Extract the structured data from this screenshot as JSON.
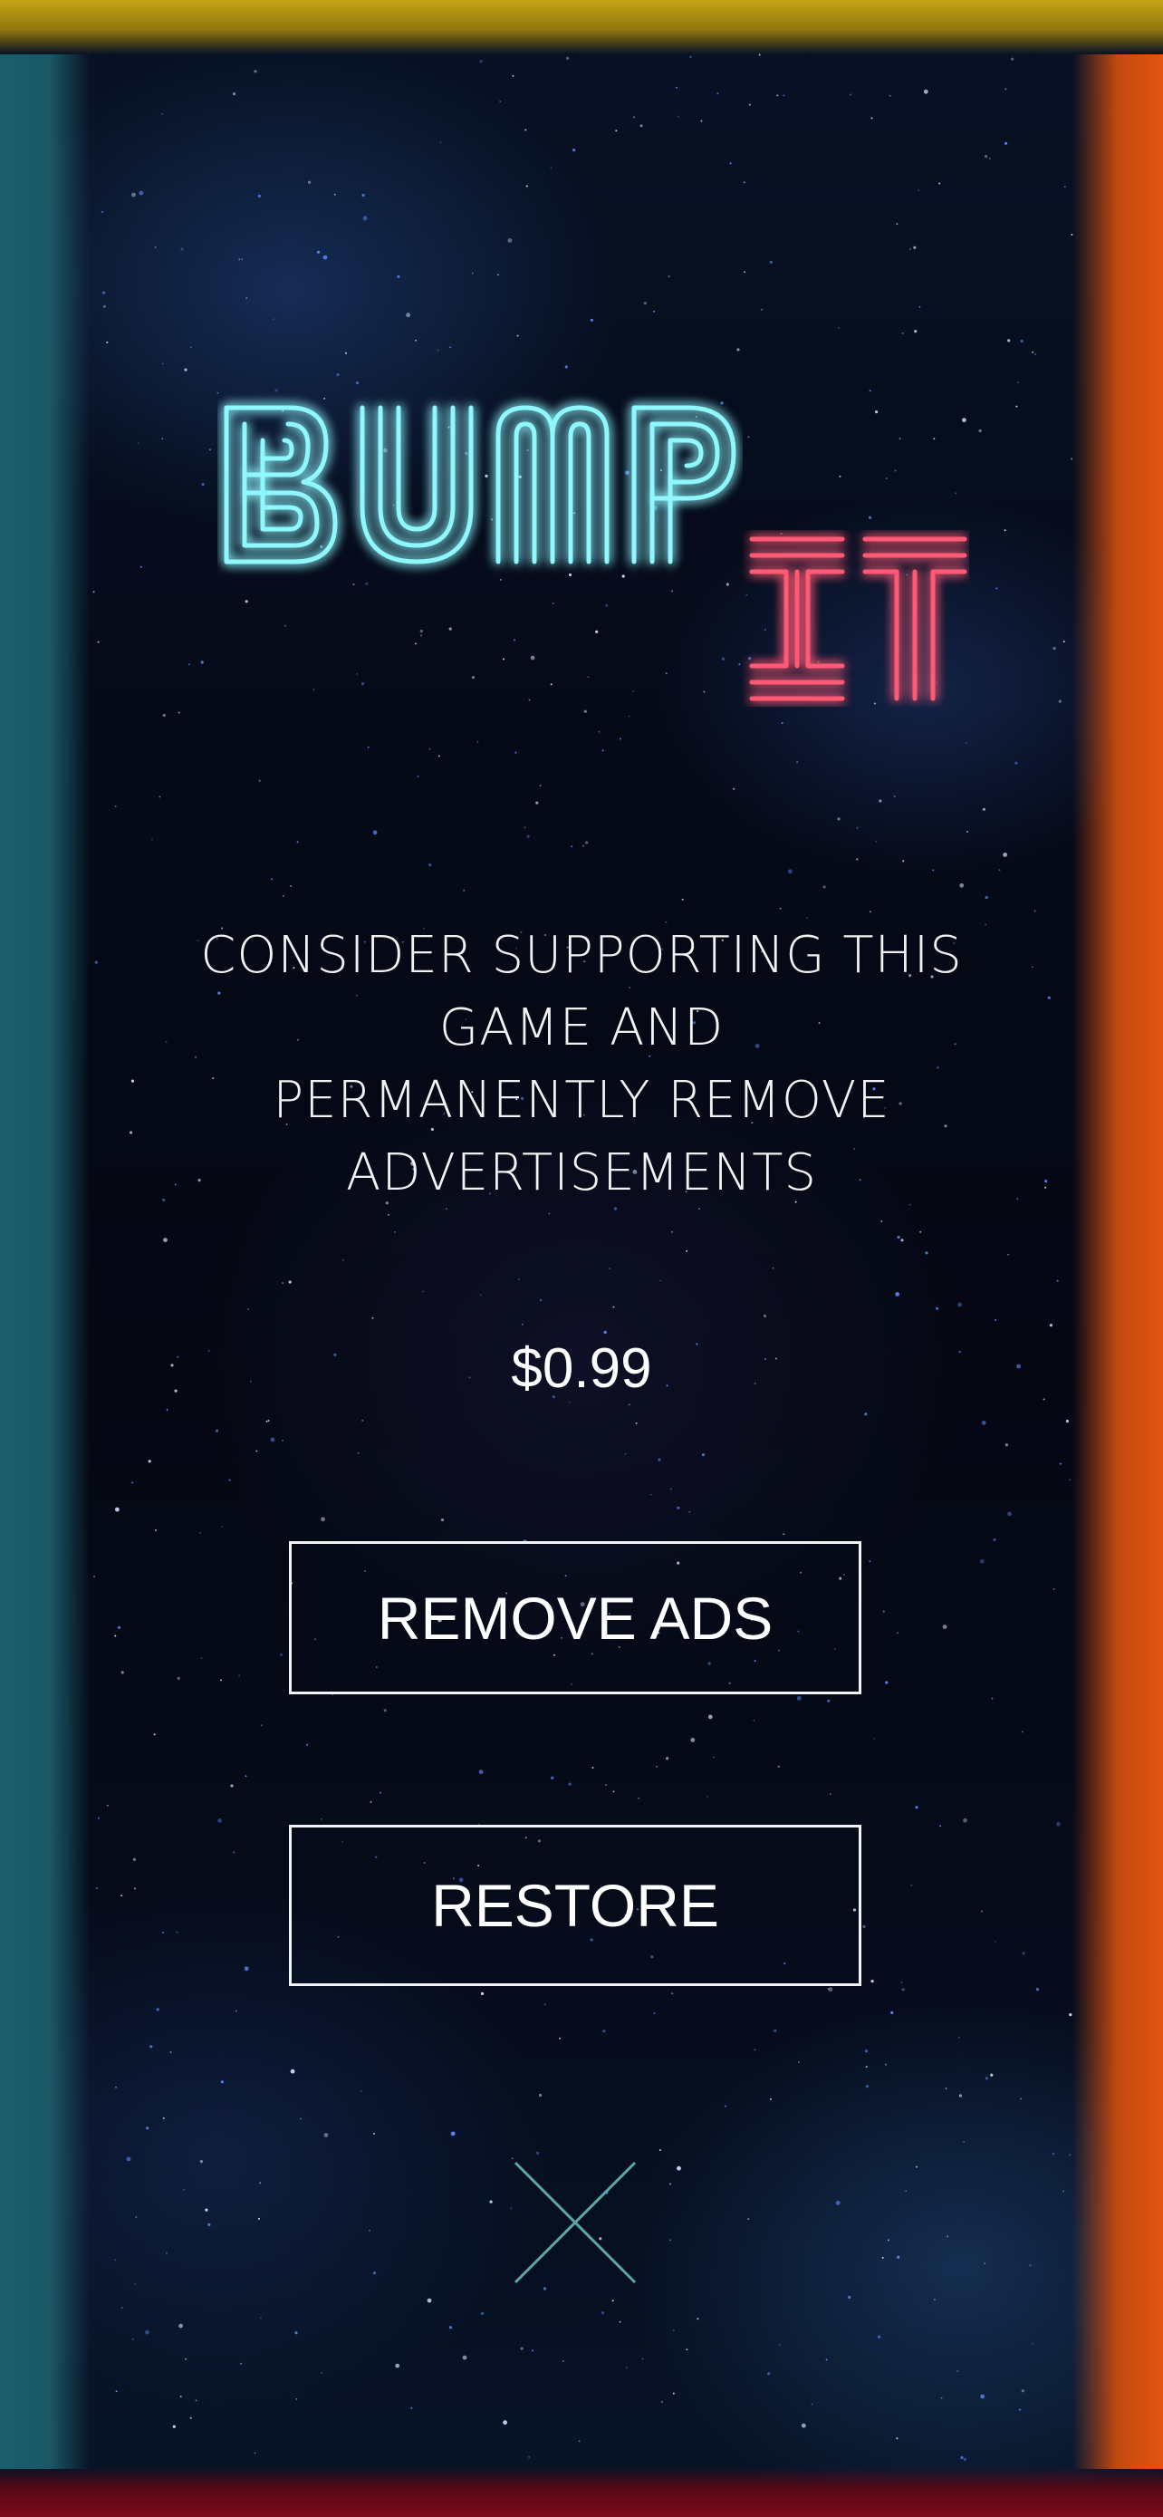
{
  "logo": {
    "word1": "BUMP",
    "word2": "IT"
  },
  "message": {
    "lines": [
      "CONSIDER SUPPORTING THIS",
      "GAME AND",
      "PERMANENTLY REMOVE",
      "ADVERTISEMENTS"
    ]
  },
  "price": "$0.99",
  "buttons": {
    "remove_ads": "REMOVE ADS",
    "restore": "RESTORE"
  },
  "icons": {
    "close": "close-icon"
  },
  "colors": {
    "edge_top": "#c5a414",
    "edge_left": "#1b5f6c",
    "edge_right": "#e1550f",
    "edge_bottom": "#7a0b1c",
    "logo_cyan": "#6ff5ff",
    "logo_red": "#ff3b5a",
    "close_icon": "#5aa8a8"
  }
}
